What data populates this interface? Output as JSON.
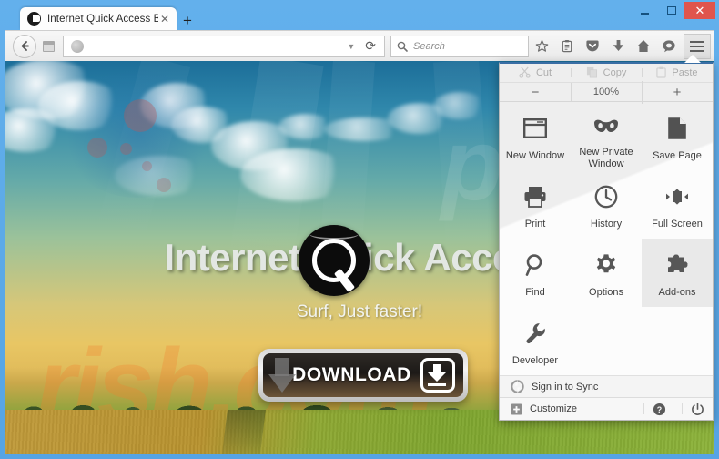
{
  "window": {
    "controls": {
      "minimize": "–",
      "maximize": "□",
      "close": "✕"
    }
  },
  "tabbar": {
    "tab_title": "Internet Quick Access Brow...",
    "tab_close": "✕",
    "new_tab": "+"
  },
  "toolbar": {
    "back": "←",
    "url_value": "",
    "url_dropdown": "▼",
    "reload": "⟳",
    "search_placeholder": "Search",
    "icons": [
      "star-icon",
      "reader-icon",
      "pocket-icon",
      "downloads-icon",
      "home-icon",
      "chat-icon",
      "hamburger-icon"
    ]
  },
  "page": {
    "hero_title": "Internet Quick Access",
    "hero_subtitle": "Surf, Just faster!",
    "download_label": "DOWNLOAD",
    "watermark": "rish.com",
    "watermark_top": "pcri"
  },
  "menu": {
    "edit_row": [
      {
        "label": "Cut",
        "icon": "scissors-icon",
        "disabled": true
      },
      {
        "label": "Copy",
        "icon": "copy-icon",
        "disabled": true
      },
      {
        "label": "Paste",
        "icon": "clipboard-icon",
        "disabled": true
      }
    ],
    "zoom_row": {
      "minus": "−",
      "level": "100%",
      "plus": "+"
    },
    "grid": [
      {
        "label": "New Window",
        "icon": "window-icon",
        "selected": false
      },
      {
        "label": "New Private Window",
        "icon": "mask-icon",
        "selected": false
      },
      {
        "label": "Save Page",
        "icon": "page-icon",
        "selected": false
      },
      {
        "label": "Print",
        "icon": "printer-icon",
        "selected": false
      },
      {
        "label": "History",
        "icon": "clock-icon",
        "selected": false
      },
      {
        "label": "Full Screen",
        "icon": "fullscreen-icon",
        "selected": false
      },
      {
        "label": "Find",
        "icon": "magnifier-icon",
        "selected": false
      },
      {
        "label": "Options",
        "icon": "gear-icon",
        "selected": false
      },
      {
        "label": "Add-ons",
        "icon": "puzzle-icon",
        "selected": true
      },
      {
        "label": "Developer",
        "icon": "wrench-icon",
        "selected": false
      }
    ],
    "sync_label": "Sign in to Sync",
    "sync_icon": "sync-icon",
    "customize_label": "Customize",
    "customize_icon": "plus-box-icon",
    "help_icon": "help-icon",
    "quit_icon": "power-icon"
  },
  "colors": {
    "title_bar": "#5aa9e8",
    "close_button": "#e0554d",
    "panel_top_border": "#3a6ea5",
    "watermark": "#f1802d",
    "selected_cell": "#e9e9e9"
  }
}
